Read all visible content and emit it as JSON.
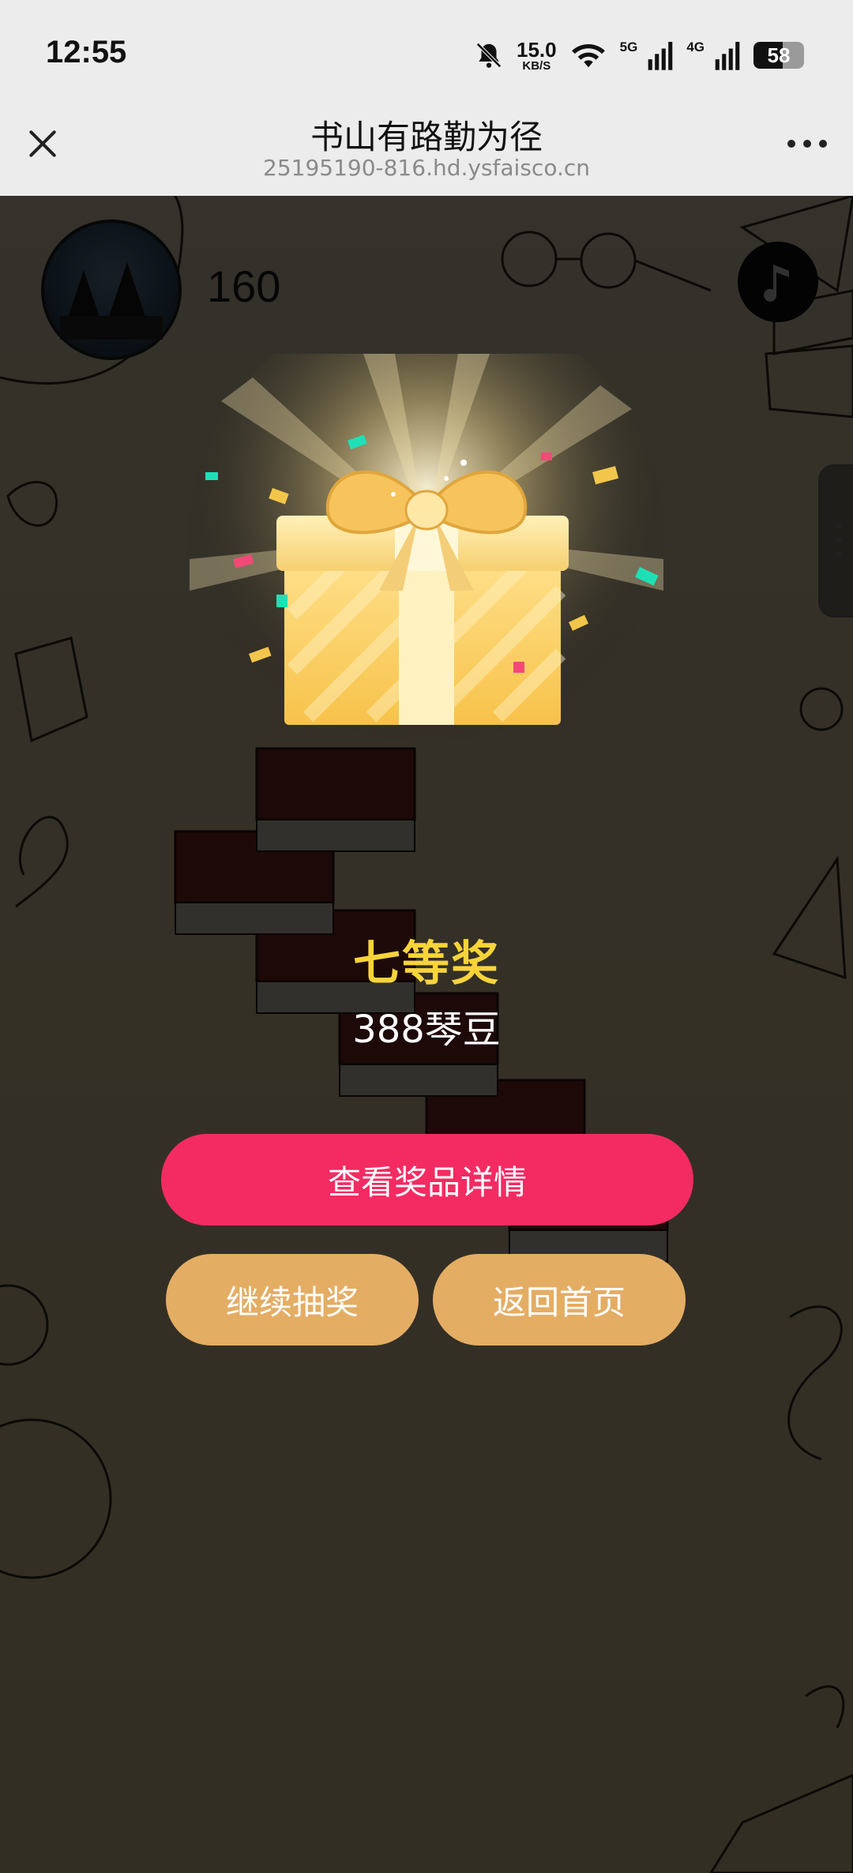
{
  "status_bar": {
    "time": "12:55",
    "speed_value": "15.0",
    "speed_unit": "KB/S",
    "network_5g": "5G",
    "network_4g": "4G",
    "battery": "58"
  },
  "browser": {
    "title": "书山有路勤为径",
    "url": "25195190-816.hd.ysfaisco.cn",
    "close_icon": "close-icon",
    "more_icon": "more-icon"
  },
  "game": {
    "score": "160"
  },
  "prize": {
    "level": "七等奖",
    "detail": "388琴豆"
  },
  "buttons": {
    "view_details": "查看奖品详情",
    "continue_draw": "继续抽奖",
    "back_home": "返回首页"
  },
  "colors": {
    "primary_button": "#f32b62",
    "secondary_button": "#e4ad64",
    "prize_level_text": "#f8d43a"
  }
}
